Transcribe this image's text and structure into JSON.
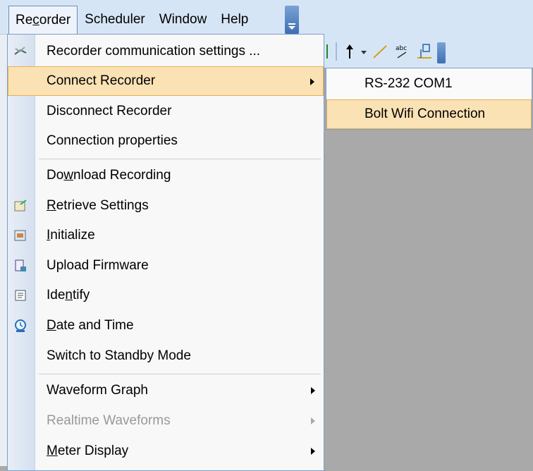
{
  "menubar": {
    "items": [
      {
        "pre": "Re",
        "acc": "c",
        "post": "order"
      },
      {
        "label": "Scheduler"
      },
      {
        "label": "Window"
      },
      {
        "label": "Help"
      }
    ]
  },
  "recorder_menu": {
    "items": [
      {
        "label": "Recorder communication settings ...",
        "icon": "network-plug-icon"
      },
      {
        "label": "Connect Recorder",
        "submenu": true
      },
      {
        "label": "Disconnect Recorder"
      },
      {
        "label": "Connection properties"
      },
      {
        "pre": "Do",
        "acc": "w",
        "post": "nload Recording"
      },
      {
        "pre": "",
        "acc": "R",
        "post": "etrieve Settings",
        "icon": "retrieve-settings-icon"
      },
      {
        "pre": "",
        "acc": "I",
        "post": "nitialize",
        "icon": "initialize-icon"
      },
      {
        "label": "Upload Firmware",
        "icon": "upload-firmware-icon"
      },
      {
        "pre": "Ide",
        "acc": "n",
        "post": "tify",
        "icon": "identify-icon"
      },
      {
        "pre": "",
        "acc": "D",
        "post": "ate and Time",
        "icon": "clock-icon"
      },
      {
        "label": "Switch to Standby Mode"
      },
      {
        "label": "Waveform Graph",
        "submenu": true
      },
      {
        "label": "Realtime Waveforms",
        "submenu": true,
        "disabled": true
      },
      {
        "pre": "",
        "acc": "M",
        "post": "eter Display",
        "submenu": true
      }
    ]
  },
  "connect_submenu": {
    "items": [
      {
        "label": "RS-232 COM1"
      },
      {
        "label": "Bolt Wifi Connection"
      }
    ]
  },
  "toolbar": {
    "icons": [
      "line-icon",
      "arrow-up-icon",
      "dropdown-icon",
      "diagonal-line-icon",
      "text-label-icon",
      "chart-icon"
    ]
  },
  "colors": {
    "highlight": "#fbe2b5",
    "highlight_border": "#e5b055",
    "menubar": "#d6e5f6",
    "background": "#a9a9a9"
  }
}
